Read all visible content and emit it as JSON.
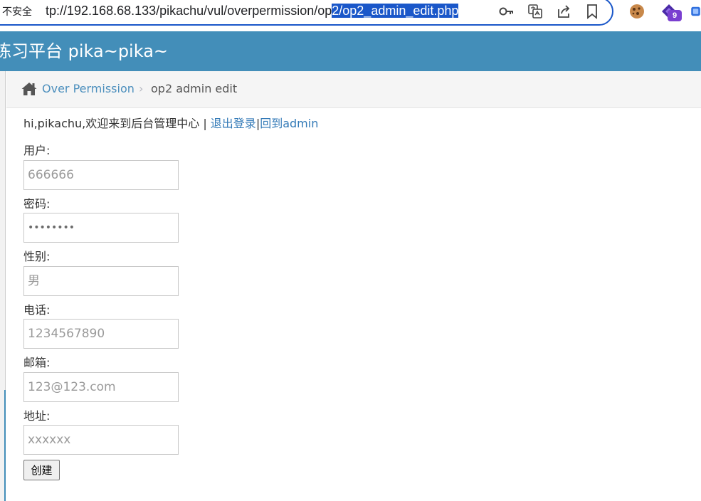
{
  "browser": {
    "security_label": "不安全",
    "url_unselected": "tp://192.168.68.133/pikachu/vul/overpermission/op",
    "url_selected": "2/op2_admin_edit.php",
    "extension_badge": "9"
  },
  "header": {
    "title": "练习平台 pika~pika~"
  },
  "breadcrumb": {
    "parent": "Over Permission",
    "separator": "›",
    "current": "op2 admin edit"
  },
  "greeting": {
    "text": "hi,pikachu,欢迎来到后台管理中心 | ",
    "logout_label": "退出登录",
    "divider": "|",
    "back_label": "回到admin"
  },
  "form": {
    "username_label": "用户:",
    "username_placeholder": "666666",
    "password_label": "密码:",
    "password_value": "••••••••",
    "sex_label": "性别:",
    "sex_placeholder": "男",
    "phone_label": "电话:",
    "phone_placeholder": "1234567890",
    "email_label": "邮箱:",
    "email_placeholder": "123@123.com",
    "address_label": "地址:",
    "address_placeholder": "xxxxxx",
    "submit_label": "创建"
  },
  "colors": {
    "header_bg": "#438eb9",
    "link": "#337ab7",
    "omnibox_border": "#1a57c9"
  }
}
